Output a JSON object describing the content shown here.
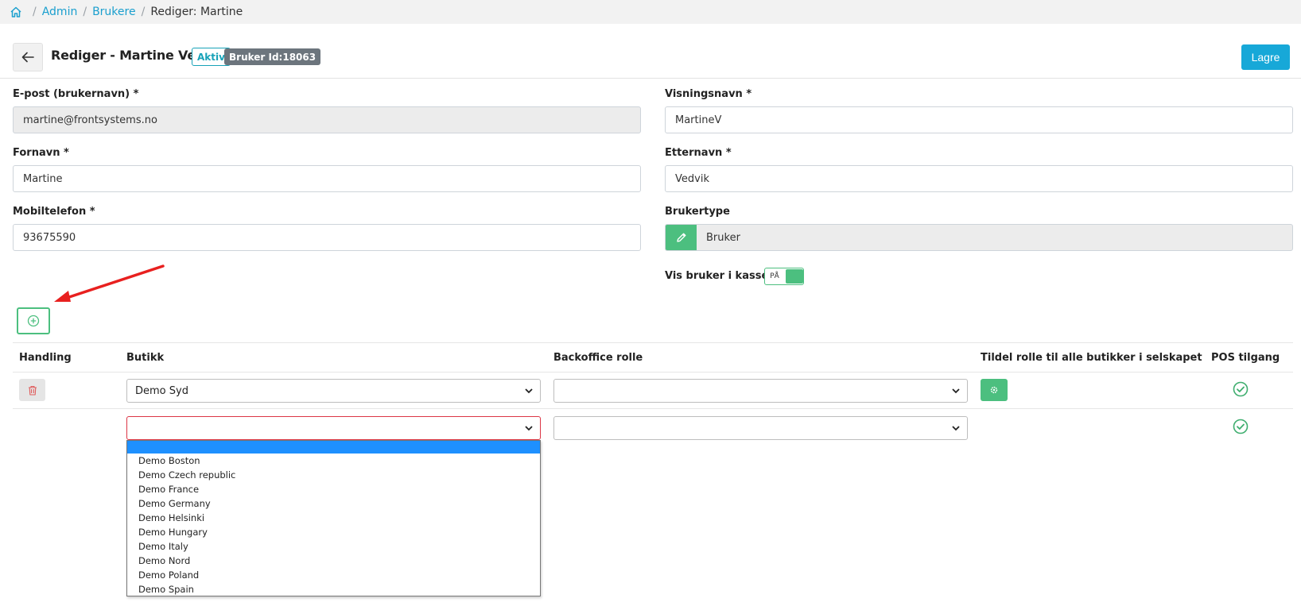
{
  "breadcrumb": {
    "items": [
      {
        "label": "Admin"
      },
      {
        "label": "Brukere"
      },
      {
        "label": "Rediger: Martine"
      }
    ]
  },
  "header": {
    "title": "Rediger - Martine Vedvik",
    "status_badge": "Aktiv",
    "id_badge": "Bruker Id:18063",
    "save_label": "Lagre"
  },
  "form": {
    "email": {
      "label": "E-post (brukernavn) *",
      "value": "martine@frontsystems.no"
    },
    "display_name": {
      "label": "Visningsnavn *",
      "value": "MartineV"
    },
    "first_name": {
      "label": "Fornavn *",
      "value": "Martine"
    },
    "last_name": {
      "label": "Etternavn *",
      "value": "Vedvik"
    },
    "mobile": {
      "label": "Mobiltelefon *",
      "value": "93675590"
    },
    "user_type": {
      "label": "Brukertype",
      "value": "Bruker"
    },
    "show_in_pos": {
      "label": "Vis bruker i kassen",
      "toggle_text": "PÅ",
      "on": true
    }
  },
  "table": {
    "headers": {
      "action": "Handling",
      "store": "Butikk",
      "role": "Backoffice rolle",
      "assign": "Tildel rolle til alle butikker i selskapet",
      "pos": "POS tilgang"
    },
    "rows": [
      {
        "store": "Demo Syd",
        "role": ""
      },
      {
        "store": "",
        "role": ""
      }
    ]
  },
  "dropdown": {
    "options": [
      "",
      "Demo Boston",
      "Demo Czech republic",
      "Demo France",
      "Demo Germany",
      "Demo Helsinki",
      "Demo Hungary",
      "Demo Italy",
      "Demo Nord",
      "Demo Poland",
      "Demo Spain"
    ]
  },
  "colors": {
    "accent_blue": "#17a8d8",
    "accent_green": "#4cbf7f",
    "annotation_red": "#e8201f"
  }
}
